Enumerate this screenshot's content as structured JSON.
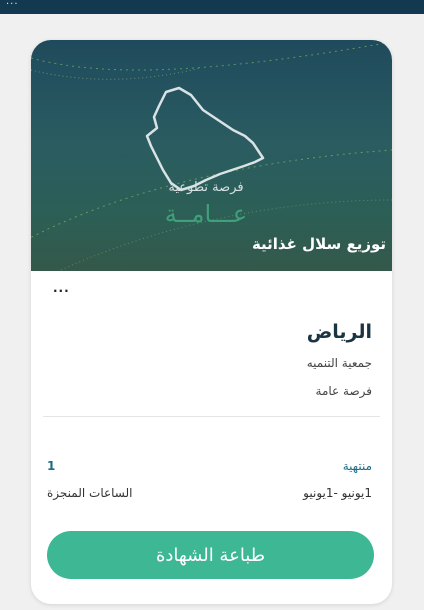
{
  "topbar": {
    "dots": "..."
  },
  "card": {
    "image": {
      "logo_text_line1": "فرصة تطوعية",
      "logo_text_line2": "عـــامــة",
      "title": "توزيع سلال غذائية"
    },
    "more_label": "...",
    "city": "الرياض",
    "organization": "جمعية التنميه",
    "opportunity_type": "فرصة عامة",
    "status": "منتهية",
    "date_range": "1يونيو -1يونيو",
    "hours_value": "1",
    "hours_label": "الساعات المنجزة",
    "print_button_label": "طباعة الشهادة"
  },
  "colors": {
    "accent": "#3eb894",
    "topbar": "#12394f",
    "status": "#1f6b86"
  }
}
